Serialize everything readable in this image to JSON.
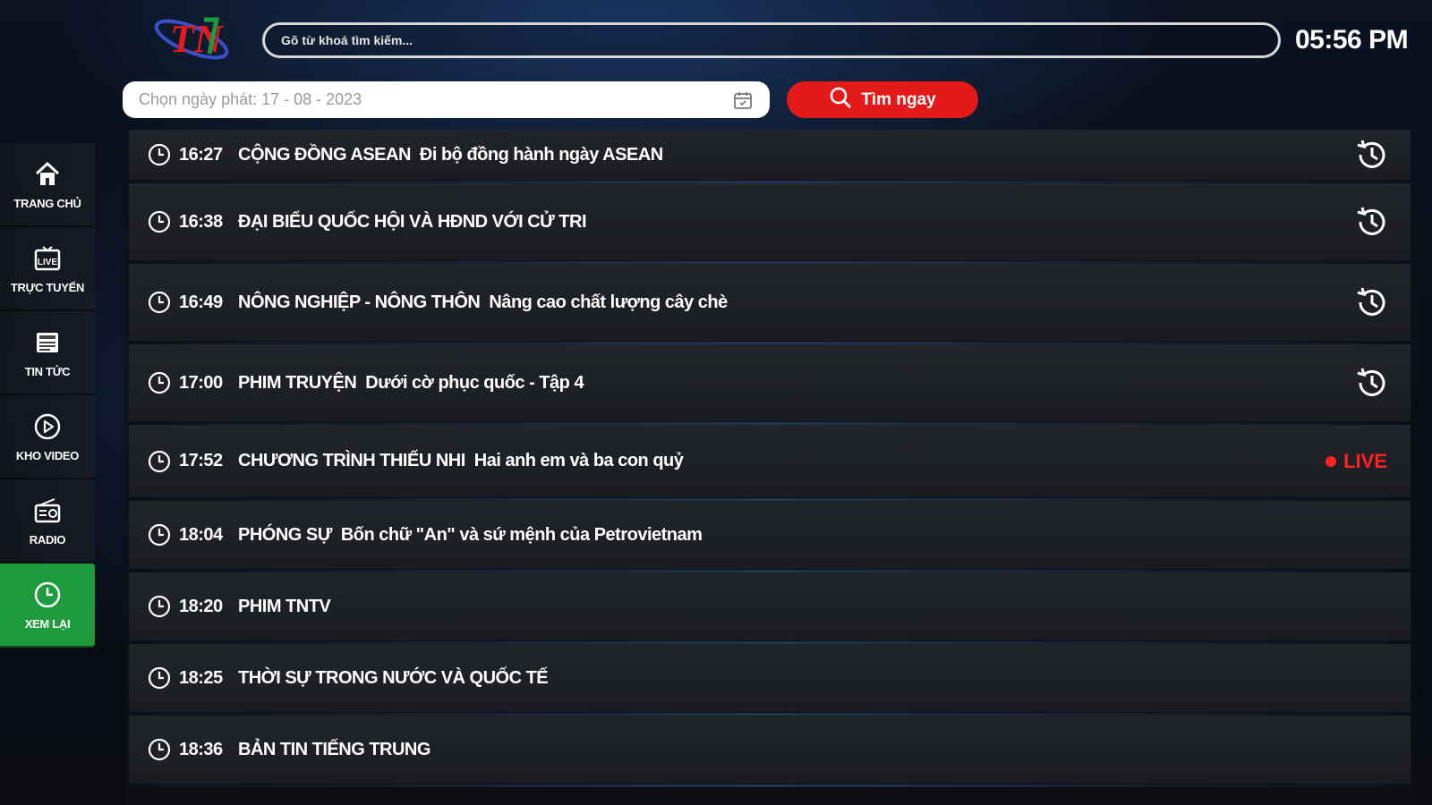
{
  "sidebar": {
    "items": [
      {
        "label": "TRANG CHỦ",
        "icon": "home-icon",
        "active": false
      },
      {
        "label": "TRỰC TUYẾN",
        "icon": "live-tv-icon",
        "active": false
      },
      {
        "label": "TIN TỨC",
        "icon": "news-icon",
        "active": false
      },
      {
        "label": "KHO VIDEO",
        "icon": "play-circle-icon",
        "active": false
      },
      {
        "label": "RADIO",
        "icon": "radio-icon",
        "active": false
      },
      {
        "label": "XEM LẠI",
        "icon": "clock-icon",
        "active": true
      }
    ]
  },
  "header": {
    "logo_text": "TN",
    "search_placeholder": "Gõ từ khoá tìm kiếm...",
    "clock": "05:56 PM",
    "date_placeholder": "Chọn ngày phát: 17 - 08 - 2023",
    "find_button": "Tìm ngay"
  },
  "colors": {
    "accent_green": "#1e9b3c",
    "button_red": "#e41a1a",
    "live_red": "#ff2020"
  },
  "schedule": {
    "live_label": "LIVE",
    "rows": [
      {
        "time": "16:27",
        "program": "CỘNG ĐỒNG ASEAN",
        "desc": "Đi bộ đồng hành ngày ASEAN",
        "status": "replay"
      },
      {
        "time": "16:38",
        "program": "ĐẠI BIỂU QUỐC HỘI VÀ HĐND VỚI CỬ TRI",
        "desc": "",
        "status": "replay"
      },
      {
        "time": "16:49",
        "program": "NÔNG NGHIỆP - NÔNG THÔN",
        "desc": "Nâng cao chất lượng cây chè",
        "status": "replay"
      },
      {
        "time": "17:00",
        "program": "PHIM TRUYỆN",
        "desc": "Dưới cờ phục quốc - Tập 4",
        "status": "replay"
      },
      {
        "time": "17:52",
        "program": "CHƯƠNG TRÌNH THIẾU NHI",
        "desc": "Hai anh em và ba con quỷ",
        "status": "live"
      },
      {
        "time": "18:04",
        "program": "PHÓNG SỰ",
        "desc": "Bốn chữ \"An\" và sứ mệnh của Petrovietnam",
        "status": "none"
      },
      {
        "time": "18:20",
        "program": "PHIM TNTV",
        "desc": "",
        "status": "none"
      },
      {
        "time": "18:25",
        "program": "THỜI SỰ TRONG NƯỚC VÀ QUỐC TẾ",
        "desc": "",
        "status": "none"
      },
      {
        "time": "18:36",
        "program": "BẢN TIN TIẾNG TRUNG",
        "desc": "",
        "status": "none"
      }
    ]
  }
}
